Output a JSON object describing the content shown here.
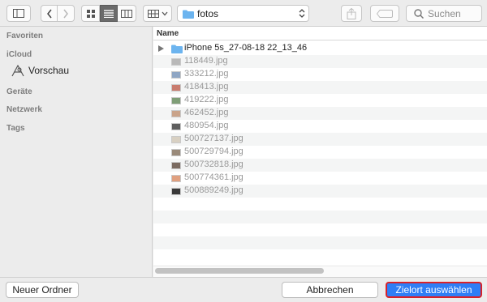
{
  "toolbar": {
    "path_label": "fotos",
    "search_placeholder": "Suchen"
  },
  "sidebar": {
    "favorites_heading": "Favoriten",
    "icloud_heading": "iCloud",
    "icloud_items": [
      {
        "label": "Vorschau",
        "icon": "preview-app-icon"
      }
    ],
    "devices_heading": "Geräte",
    "network_heading": "Netzwerk",
    "tags_heading": "Tags"
  },
  "filelist": {
    "column_name": "Name",
    "folder": {
      "name": "iPhone 5s_27-08-18 22_13_46",
      "icon": "folder-icon"
    },
    "files": [
      {
        "name": "118449.jpg",
        "thumb_color": "#b9b9b9"
      },
      {
        "name": "333212.jpg",
        "thumb_color": "#8fa6c4"
      },
      {
        "name": "418413.jpg",
        "thumb_color": "#c97c6f"
      },
      {
        "name": "419222.jpg",
        "thumb_color": "#7f9e77"
      },
      {
        "name": "462452.jpg",
        "thumb_color": "#c9a38a"
      },
      {
        "name": "480954.jpg",
        "thumb_color": "#5f5f5f"
      },
      {
        "name": "500727137.jpg",
        "thumb_color": "#d8d0c2"
      },
      {
        "name": "500729794.jpg",
        "thumb_color": "#9a8a7a"
      },
      {
        "name": "500732818.jpg",
        "thumb_color": "#7a6a60"
      },
      {
        "name": "500774361.jpg",
        "thumb_color": "#e0a080"
      },
      {
        "name": "500889249.jpg",
        "thumb_color": "#3a3a3a"
      }
    ]
  },
  "footer": {
    "new_folder_label": "Neuer Ordner",
    "cancel_label": "Abbrechen",
    "choose_label": "Zielort auswählen"
  },
  "colors": {
    "accent": "#2f7ef6",
    "highlight_border": "#d8222a",
    "folder_blue": "#6cb4ef"
  }
}
